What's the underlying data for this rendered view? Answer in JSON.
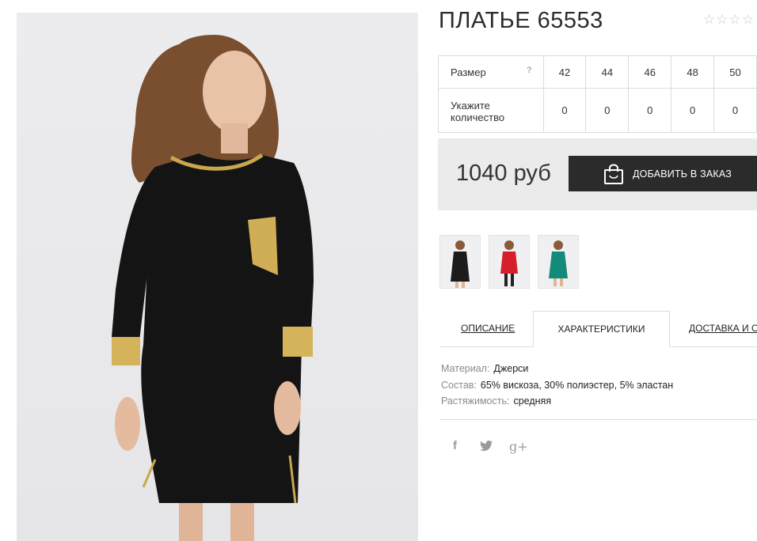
{
  "product": {
    "title": "ПЛАТЬЕ 65553",
    "rating_stars": "☆☆☆☆"
  },
  "sizes": {
    "size_label": "Размер",
    "help": "?",
    "qty_label": "Укажите количество",
    "values": [
      "42",
      "44",
      "46",
      "48",
      "50"
    ],
    "quantities": [
      "0",
      "0",
      "0",
      "0",
      "0"
    ]
  },
  "order": {
    "price": "1040 руб",
    "add_button": "ДОБАВИТЬ В ЗАКАЗ"
  },
  "thumbnails": [
    {
      "color": "#1c1c1c"
    },
    {
      "color": "#d61f2a"
    },
    {
      "color": "#138a7a"
    }
  ],
  "tabs": {
    "description": "ОПИСАНИЕ",
    "characteristics": "ХАРАКТЕРИСТИКИ",
    "delivery": "ДОСТАВКА И О"
  },
  "specs": [
    {
      "key": "Материал:",
      "value": "Джерси"
    },
    {
      "key": "Состав:",
      "value": "65% вискоза, 30% полиэстер, 5% эластан"
    },
    {
      "key": "Растяжимость:",
      "value": "средняя"
    }
  ],
  "social": {
    "facebook": "f",
    "twitter": "t",
    "google_plus": "g+"
  }
}
